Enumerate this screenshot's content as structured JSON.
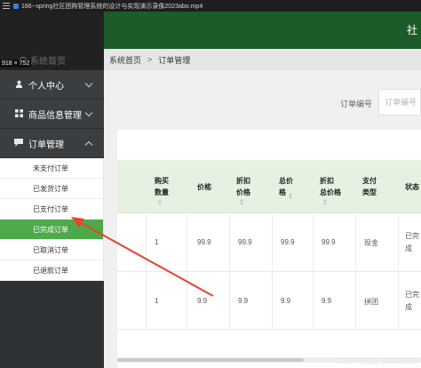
{
  "player": {
    "title": "166--spring社区团购管理系统的设计与实现演示录像2023abo.mp4",
    "dimensions": "918 × 752"
  },
  "header": {
    "right_text": "社"
  },
  "sidebar": {
    "home_label": "系统首页",
    "items": [
      {
        "label": "个人中心",
        "icon": "user-icon"
      },
      {
        "label": "商品信息管理",
        "icon": "grid-icon"
      },
      {
        "label": "订单管理",
        "icon": "chat-icon",
        "expanded": true
      }
    ],
    "order_sub_items": [
      {
        "label": "未支付订单",
        "active": false
      },
      {
        "label": "已发货订单",
        "active": false
      },
      {
        "label": "已支付订单",
        "active": false
      },
      {
        "label": "已完成订单",
        "active": true
      },
      {
        "label": "已取消订单",
        "active": false
      },
      {
        "label": "已退款订单",
        "active": false
      }
    ]
  },
  "breadcrumb": {
    "home": "系统首页",
    "separator": ">",
    "current": "订单管理"
  },
  "search": {
    "label": "订单编号",
    "placeholder": "订单编号"
  },
  "table": {
    "headers": [
      {
        "line1": "购买",
        "line2": "数量"
      },
      {
        "line1": "价格",
        "line2": ""
      },
      {
        "line1": "折扣",
        "line2": "价格"
      },
      {
        "line1": "总价",
        "line2": "格"
      },
      {
        "line1": "折扣",
        "line2": "总价格"
      },
      {
        "line1": "支付",
        "line2": "类型"
      },
      {
        "line1": "状态",
        "line2": ""
      }
    ],
    "rows": [
      {
        "qty": "1",
        "price": "99.9",
        "discount_price": "99.9",
        "total": "99.9",
        "discount_total": "99.9",
        "pay_type": "现金",
        "status_1": "已完",
        "status_2": "成"
      },
      {
        "qty": "1",
        "price": "9.9",
        "discount_price": "9.9",
        "total": "9.9",
        "discount_total": "9.9",
        "pay_type": "拼团",
        "status_1": "已完",
        "status_2": "成"
      }
    ]
  },
  "watermark": "CSDN @QQ_188083800",
  "colors": {
    "header_green": "#1d5b2a",
    "active_green": "#4ea94a",
    "table_head": "#e5f2e2",
    "annotation_red": "#e8432f",
    "sidebar_dark": "#2f3234"
  }
}
